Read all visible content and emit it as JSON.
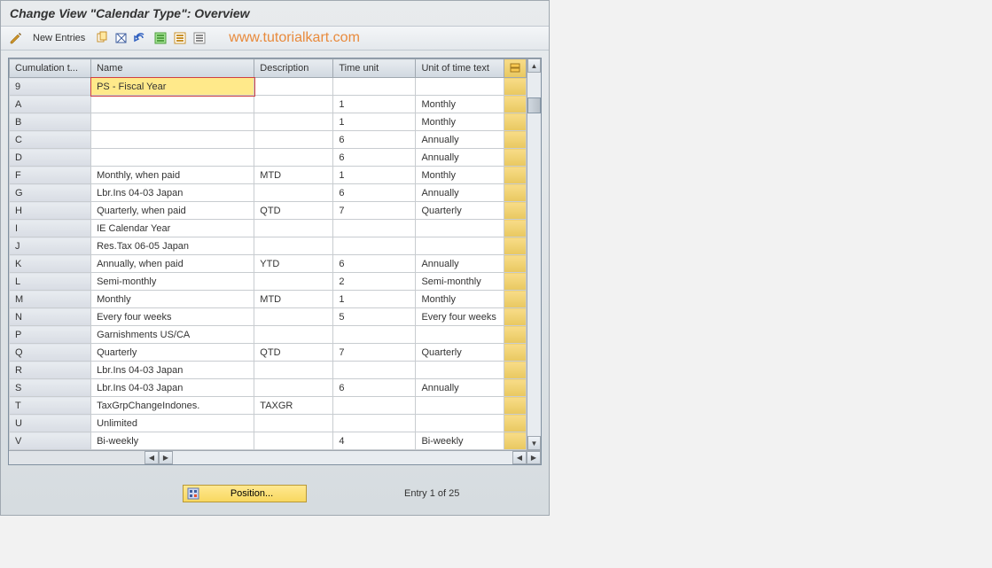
{
  "title": "Change View \"Calendar Type\": Overview",
  "toolbar": {
    "new_entries_label": "New Entries"
  },
  "watermark": "www.tutorialkart.com",
  "columns": {
    "cumulation": "Cumulation t...",
    "name": "Name",
    "description": "Description",
    "time_unit": "Time unit",
    "unit_text": "Unit of time text"
  },
  "rows": [
    {
      "code": "9",
      "name": "PS - Fiscal Year",
      "desc": "",
      "time": "",
      "unit": "",
      "selected": true
    },
    {
      "code": "A",
      "name": "",
      "desc": "",
      "time": "1",
      "unit": "Monthly"
    },
    {
      "code": "B",
      "name": "",
      "desc": "",
      "time": "1",
      "unit": "Monthly"
    },
    {
      "code": "C",
      "name": "",
      "desc": "",
      "time": "6",
      "unit": "Annually"
    },
    {
      "code": "D",
      "name": "",
      "desc": "",
      "time": "6",
      "unit": "Annually"
    },
    {
      "code": "F",
      "name": "Monthly, when paid",
      "desc": "MTD",
      "time": "1",
      "unit": "Monthly"
    },
    {
      "code": "G",
      "name": "Lbr.Ins 04-03  Japan",
      "desc": "",
      "time": "6",
      "unit": "Annually"
    },
    {
      "code": "H",
      "name": "Quarterly, when paid",
      "desc": "QTD",
      "time": "7",
      "unit": "Quarterly"
    },
    {
      "code": "I",
      "name": "IE Calendar Year",
      "desc": "",
      "time": "",
      "unit": ""
    },
    {
      "code": "J",
      "name": "Res.Tax 06-05  Japan",
      "desc": "",
      "time": "",
      "unit": ""
    },
    {
      "code": "K",
      "name": "Annually, when paid",
      "desc": "YTD",
      "time": "6",
      "unit": "Annually"
    },
    {
      "code": "L",
      "name": "Semi-monthly",
      "desc": "",
      "time": "2",
      "unit": "Semi-monthly"
    },
    {
      "code": "M",
      "name": "Monthly",
      "desc": "MTD",
      "time": "1",
      "unit": "Monthly"
    },
    {
      "code": "N",
      "name": "Every four weeks",
      "desc": "",
      "time": "5",
      "unit": "Every four weeks"
    },
    {
      "code": "P",
      "name": "Garnishments US/CA",
      "desc": "",
      "time": "",
      "unit": ""
    },
    {
      "code": "Q",
      "name": "Quarterly",
      "desc": "QTD",
      "time": "7",
      "unit": "Quarterly"
    },
    {
      "code": "R",
      "name": "Lbr.Ins 04-03  Japan",
      "desc": "",
      "time": "",
      "unit": ""
    },
    {
      "code": "S",
      "name": "Lbr.Ins 04-03  Japan",
      "desc": "",
      "time": "6",
      "unit": "Annually"
    },
    {
      "code": "T",
      "name": "TaxGrpChangeIndones.",
      "desc": "TAXGR",
      "time": "",
      "unit": ""
    },
    {
      "code": "U",
      "name": "Unlimited",
      "desc": "",
      "time": "",
      "unit": ""
    },
    {
      "code": "V",
      "name": "Bi-weekly",
      "desc": "",
      "time": "4",
      "unit": "Bi-weekly"
    }
  ],
  "footer": {
    "position_label": "Position...",
    "entry_text": "Entry 1 of 25"
  }
}
